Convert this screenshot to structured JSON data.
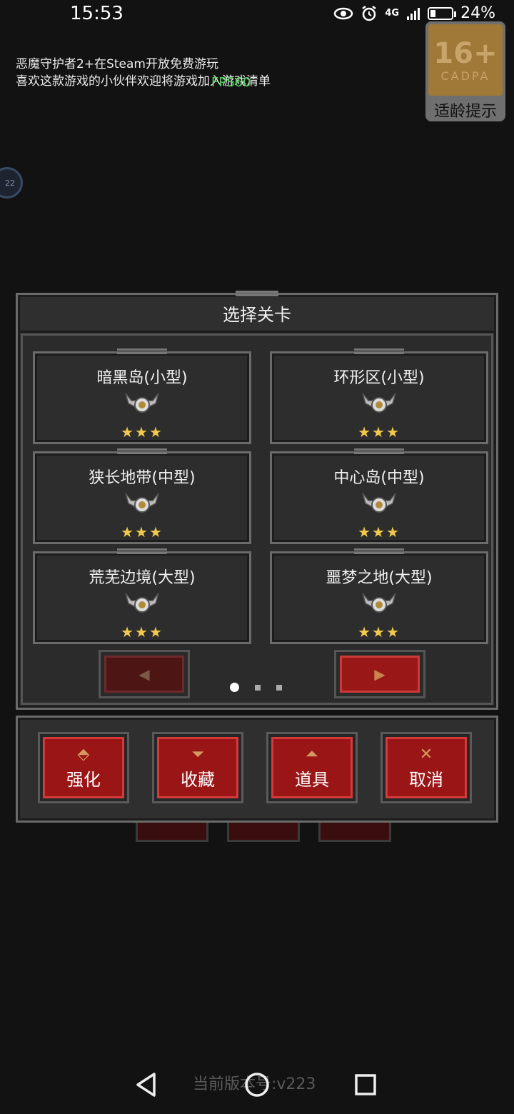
{
  "status": {
    "time": "15:53",
    "signal": "4G",
    "battery": "24%",
    "battery_level": 0.24
  },
  "notice": {
    "line1": "恶魔守护者2+在Steam开放免费游玩",
    "line2": "喜欢这款游戏的小伙伴欢迎将游戏加入游戏清单",
    "fps": "FPS60"
  },
  "age_badge": {
    "rating": "16+",
    "org": "CADPA",
    "label": "适龄提示"
  },
  "side_bubble": "22",
  "panel": {
    "title": "选择关卡",
    "levels": [
      {
        "name": "暗黑岛(小型)",
        "stars": "★★★"
      },
      {
        "name": "环形区(小型)",
        "stars": "★★★"
      },
      {
        "name": "狭长地带(中型)",
        "stars": "★★★"
      },
      {
        "name": "中心岛(中型)",
        "stars": "★★★"
      },
      {
        "name": "荒芜边境(大型)",
        "stars": "★★★"
      },
      {
        "name": "噩梦之地(大型)",
        "stars": "★★★"
      }
    ],
    "prev_icon": "◀",
    "next_icon": "▶",
    "page": 1,
    "page_count": 3
  },
  "actions": [
    {
      "label": "强化",
      "icon": "⬘",
      "icon_name": "upgrade-icon"
    },
    {
      "label": "收藏",
      "icon": "⏷",
      "icon_name": "goblet-icon"
    },
    {
      "label": "道具",
      "icon": "⏶",
      "icon_name": "potion-icon"
    },
    {
      "label": "取消",
      "icon": "✕",
      "icon_name": "close-icon"
    }
  ],
  "version": "当前版本号:v223"
}
